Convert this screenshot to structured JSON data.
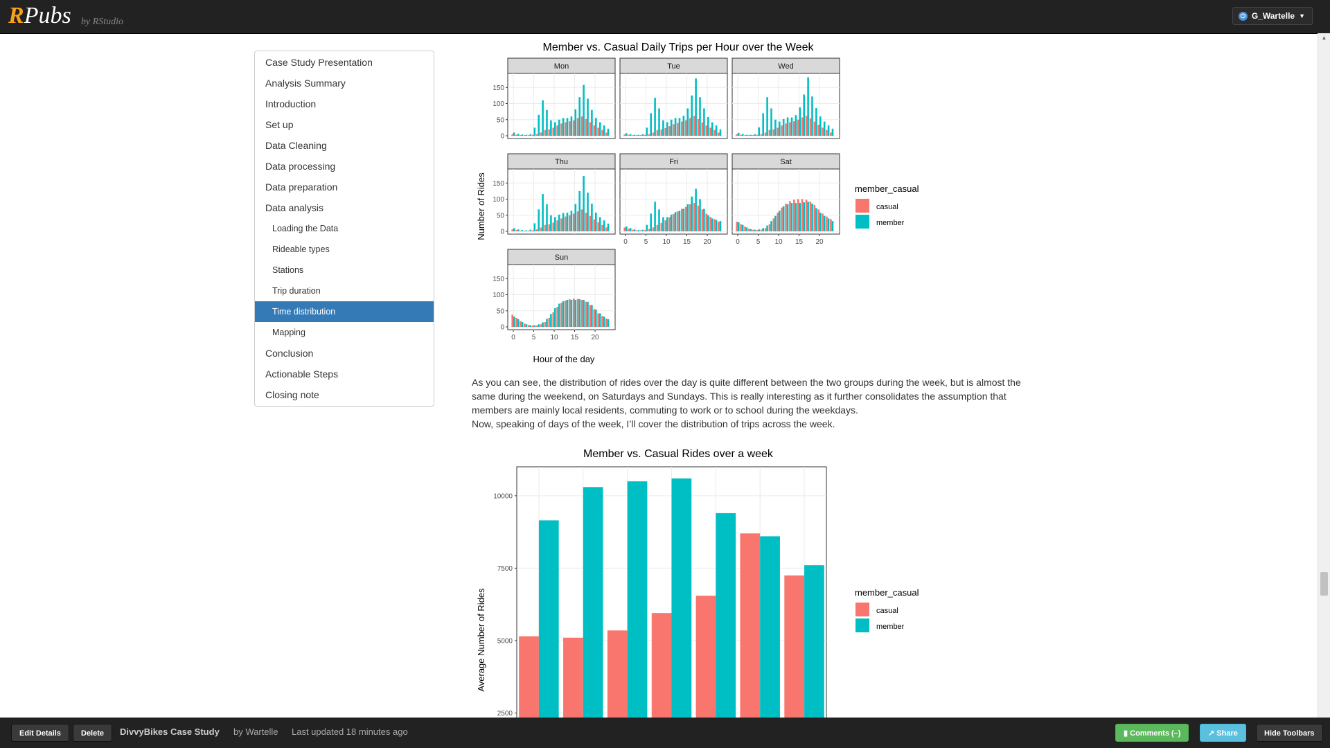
{
  "topbar": {
    "logo_r": "R",
    "logo_pubs": "Pubs",
    "byline": "by RStudio",
    "user_label": "G_Wartelle"
  },
  "toc": {
    "items": [
      {
        "label": "Case Study Presentation",
        "level": 1
      },
      {
        "label": "Analysis Summary",
        "level": 1
      },
      {
        "label": "Introduction",
        "level": 1
      },
      {
        "label": "Set up",
        "level": 1
      },
      {
        "label": "Data Cleaning",
        "level": 1
      },
      {
        "label": "Data processing",
        "level": 1
      },
      {
        "label": "Data preparation",
        "level": 1
      },
      {
        "label": "Data analysis",
        "level": 1
      },
      {
        "label": "Loading the Data",
        "level": 2
      },
      {
        "label": "Rideable types",
        "level": 2
      },
      {
        "label": "Stations",
        "level": 2
      },
      {
        "label": "Trip duration",
        "level": 2
      },
      {
        "label": "Time distribution",
        "level": 2,
        "active": true
      },
      {
        "label": "Mapping",
        "level": 2
      },
      {
        "label": "Conclusion",
        "level": 1
      },
      {
        "label": "Actionable Steps",
        "level": 1
      },
      {
        "label": "Closing note",
        "level": 1
      }
    ]
  },
  "content": {
    "paragraph1": "As you can see, the distribution of rides over the day is quite different between the two groups during the week, but is almost the same during the weekend, on Saturdays and Sundays. This is really interesting as it further consolidates the assumption that members are mainly local residents, commuting to work or to school during the weekdays.",
    "paragraph2": "Now, speaking of days of the week, I’ll cover the distribution of trips across the week."
  },
  "colors": {
    "casual": "#F8766D",
    "member": "#00BFC4",
    "active": "#337ab7"
  },
  "chart_data": [
    {
      "type": "bar",
      "title": "Member vs. Casual Daily Trips per Hour over the Week",
      "xlabel": "Hour of the day",
      "ylabel": "Number of Rides",
      "x_ticks": [
        0,
        5,
        10,
        15,
        20
      ],
      "y_ticks": [
        0,
        50,
        100,
        150
      ],
      "ylim": [
        0,
        185
      ],
      "legend_title": "member_casual",
      "legend_position": "right",
      "facets": [
        {
          "name": "Mon",
          "casual": [
            5,
            3,
            2,
            2,
            2,
            3,
            5,
            10,
            18,
            20,
            25,
            32,
            38,
            42,
            45,
            48,
            55,
            60,
            52,
            42,
            32,
            25,
            18,
            10
          ],
          "member": [
            10,
            6,
            4,
            3,
            5,
            25,
            65,
            110,
            80,
            48,
            42,
            50,
            55,
            55,
            60,
            82,
            120,
            158,
            115,
            80,
            55,
            42,
            32,
            22
          ]
        },
        {
          "name": "Tue",
          "casual": [
            4,
            3,
            2,
            2,
            2,
            3,
            5,
            10,
            18,
            20,
            24,
            30,
            36,
            40,
            44,
            48,
            55,
            62,
            52,
            42,
            32,
            25,
            18,
            10
          ],
          "member": [
            8,
            5,
            3,
            3,
            5,
            25,
            70,
            118,
            85,
            48,
            42,
            50,
            55,
            55,
            62,
            85,
            125,
            178,
            120,
            85,
            58,
            42,
            32,
            20
          ]
        },
        {
          "name": "Wed",
          "casual": [
            5,
            3,
            2,
            2,
            2,
            3,
            5,
            10,
            18,
            20,
            25,
            32,
            38,
            42,
            45,
            50,
            57,
            62,
            54,
            44,
            34,
            25,
            18,
            10
          ],
          "member": [
            9,
            6,
            3,
            3,
            5,
            26,
            70,
            120,
            85,
            50,
            44,
            52,
            57,
            57,
            64,
            88,
            128,
            182,
            122,
            86,
            60,
            44,
            32,
            22
          ]
        },
        {
          "name": "Thu",
          "casual": [
            6,
            4,
            2,
            2,
            2,
            3,
            6,
            12,
            20,
            22,
            27,
            34,
            40,
            46,
            50,
            55,
            62,
            68,
            58,
            48,
            37,
            28,
            20,
            12
          ],
          "member": [
            10,
            6,
            4,
            3,
            5,
            25,
            68,
            116,
            84,
            50,
            44,
            52,
            57,
            58,
            64,
            85,
            125,
            172,
            120,
            86,
            58,
            44,
            34,
            24
          ]
        },
        {
          "name": "Fri",
          "casual": [
            12,
            8,
            5,
            3,
            3,
            4,
            7,
            12,
            20,
            26,
            34,
            44,
            54,
            62,
            70,
            76,
            84,
            88,
            80,
            68,
            55,
            45,
            38,
            30
          ],
          "member": [
            15,
            10,
            6,
            4,
            5,
            20,
            55,
            92,
            68,
            44,
            44,
            52,
            60,
            64,
            70,
            84,
            108,
            132,
            100,
            70,
            50,
            40,
            35,
            32
          ]
        },
        {
          "name": "Sat",
          "casual": [
            30,
            22,
            15,
            8,
            5,
            4,
            5,
            10,
            22,
            40,
            58,
            74,
            86,
            94,
            98,
            100,
            100,
            98,
            92,
            82,
            68,
            55,
            46,
            38
          ],
          "member": [
            28,
            20,
            12,
            7,
            5,
            6,
            10,
            18,
            32,
            48,
            64,
            78,
            84,
            88,
            88,
            88,
            90,
            92,
            86,
            72,
            58,
            48,
            40,
            32
          ]
        },
        {
          "name": "Sun",
          "casual": [
            38,
            28,
            18,
            10,
            6,
            4,
            4,
            8,
            15,
            28,
            45,
            62,
            75,
            82,
            86,
            88,
            87,
            84,
            78,
            68,
            55,
            42,
            34,
            26
          ],
          "member": [
            32,
            24,
            15,
            8,
            5,
            5,
            8,
            14,
            25,
            40,
            58,
            72,
            80,
            84,
            84,
            84,
            86,
            84,
            78,
            68,
            54,
            42,
            32,
            24
          ]
        }
      ]
    },
    {
      "type": "bar",
      "title": "Member vs. Casual Rides over a week",
      "xlabel": "",
      "ylabel": "Average Number of Rides",
      "y_ticks": [
        2500,
        5000,
        7500,
        10000
      ],
      "ylim": [
        0,
        11000
      ],
      "legend_title": "member_casual",
      "legend_position": "right",
      "series": [
        {
          "name": "casual",
          "values": [
            5150,
            5100,
            5350,
            5950,
            6550,
            8700,
            7250
          ]
        },
        {
          "name": "member",
          "values": [
            9150,
            10300,
            10500,
            10600,
            9400,
            8600,
            7600
          ]
        }
      ]
    }
  ],
  "bottombar": {
    "edit_label": "Edit Details",
    "delete_label": "Delete",
    "doc_title": "DivvyBikes Case Study",
    "author": "by Wartelle",
    "updated": "Last updated 18 minutes ago",
    "comments_label": "Comments (–)",
    "share_label": "Share",
    "hide_label": "Hide Toolbars"
  }
}
